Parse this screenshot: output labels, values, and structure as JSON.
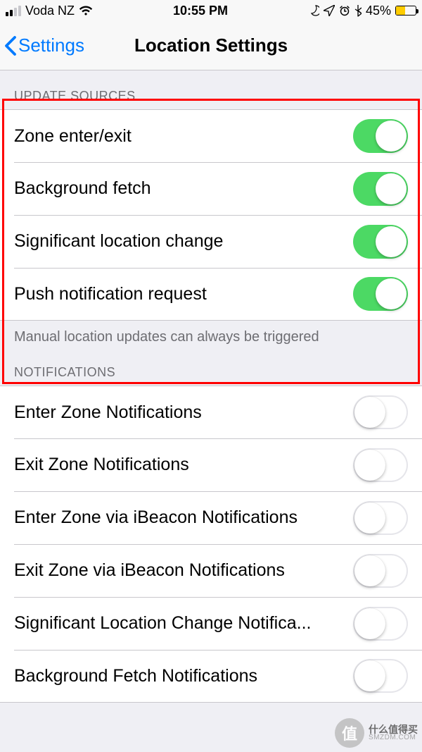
{
  "status": {
    "carrier": "Voda NZ",
    "time": "10:55 PM",
    "battery_pct": "45%"
  },
  "nav": {
    "back_label": "Settings",
    "title": "Location Settings"
  },
  "sections": {
    "update_sources": {
      "header": "UPDATE SOURCES",
      "footer": "Manual location updates can always be triggered",
      "items": [
        {
          "label": "Zone enter/exit",
          "on": true
        },
        {
          "label": "Background fetch",
          "on": true
        },
        {
          "label": "Significant location change",
          "on": true
        },
        {
          "label": "Push notification request",
          "on": true
        }
      ]
    },
    "notifications": {
      "header": "NOTIFICATIONS",
      "items": [
        {
          "label": "Enter Zone Notifications",
          "on": false
        },
        {
          "label": "Exit Zone Notifications",
          "on": false
        },
        {
          "label": "Enter Zone via iBeacon Notifications",
          "on": false
        },
        {
          "label": "Exit Zone via iBeacon Notifications",
          "on": false
        },
        {
          "label": "Significant Location Change Notifica...",
          "on": false
        },
        {
          "label": "Background Fetch Notifications",
          "on": false
        }
      ]
    }
  },
  "watermark": {
    "glyph": "值",
    "line1": "什么值得买",
    "line2": "SMZDM.COM"
  }
}
